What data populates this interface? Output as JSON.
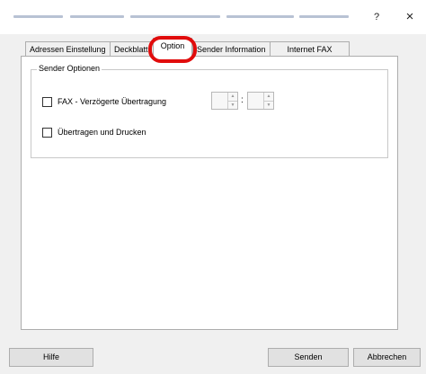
{
  "window": {
    "help_label": "?",
    "close_label": "×"
  },
  "tabs": [
    {
      "label": "Adressen Einstellung"
    },
    {
      "label": "Deckblatt"
    },
    {
      "label": "Option"
    },
    {
      "label": "Sender Information"
    },
    {
      "label": "Internet FAX"
    }
  ],
  "active_tab": "Option",
  "sender_options": {
    "legend": "Sender Optionen",
    "delayed": {
      "label": "FAX - Verzögerte Übertragung",
      "checked": false
    },
    "time_separator": ":",
    "transmit_print": {
      "label": "Übertragen und Drucken",
      "checked": false
    }
  },
  "buttons": {
    "help": "Hilfe",
    "send": "Senden",
    "cancel": "Abbrechen"
  }
}
